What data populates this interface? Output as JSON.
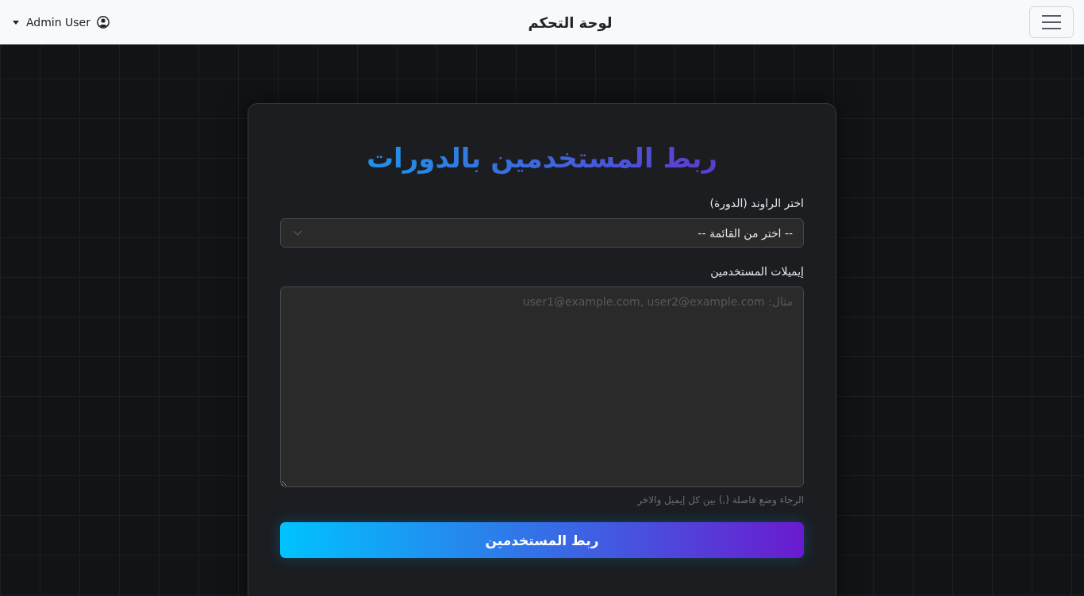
{
  "navbar": {
    "user_menu": {
      "label": "Admin User"
    },
    "brand": "لوحة التحكم"
  },
  "form": {
    "title": "ربط المستخدمين بالدورات",
    "fields": [
      {
        "kind": "select",
        "label": "اختر الراوند (الدورة)",
        "value": "-- اختر من القائمة --"
      },
      {
        "kind": "textarea",
        "label": "إيميلات المستخدمين",
        "placeholder": "مثال: user1@example.com, user2@example.com",
        "help": "الرجاء وضع فاصلة (,) بين كل إيميل والاخر"
      }
    ],
    "submit": "ربط المستخدمين"
  }
}
